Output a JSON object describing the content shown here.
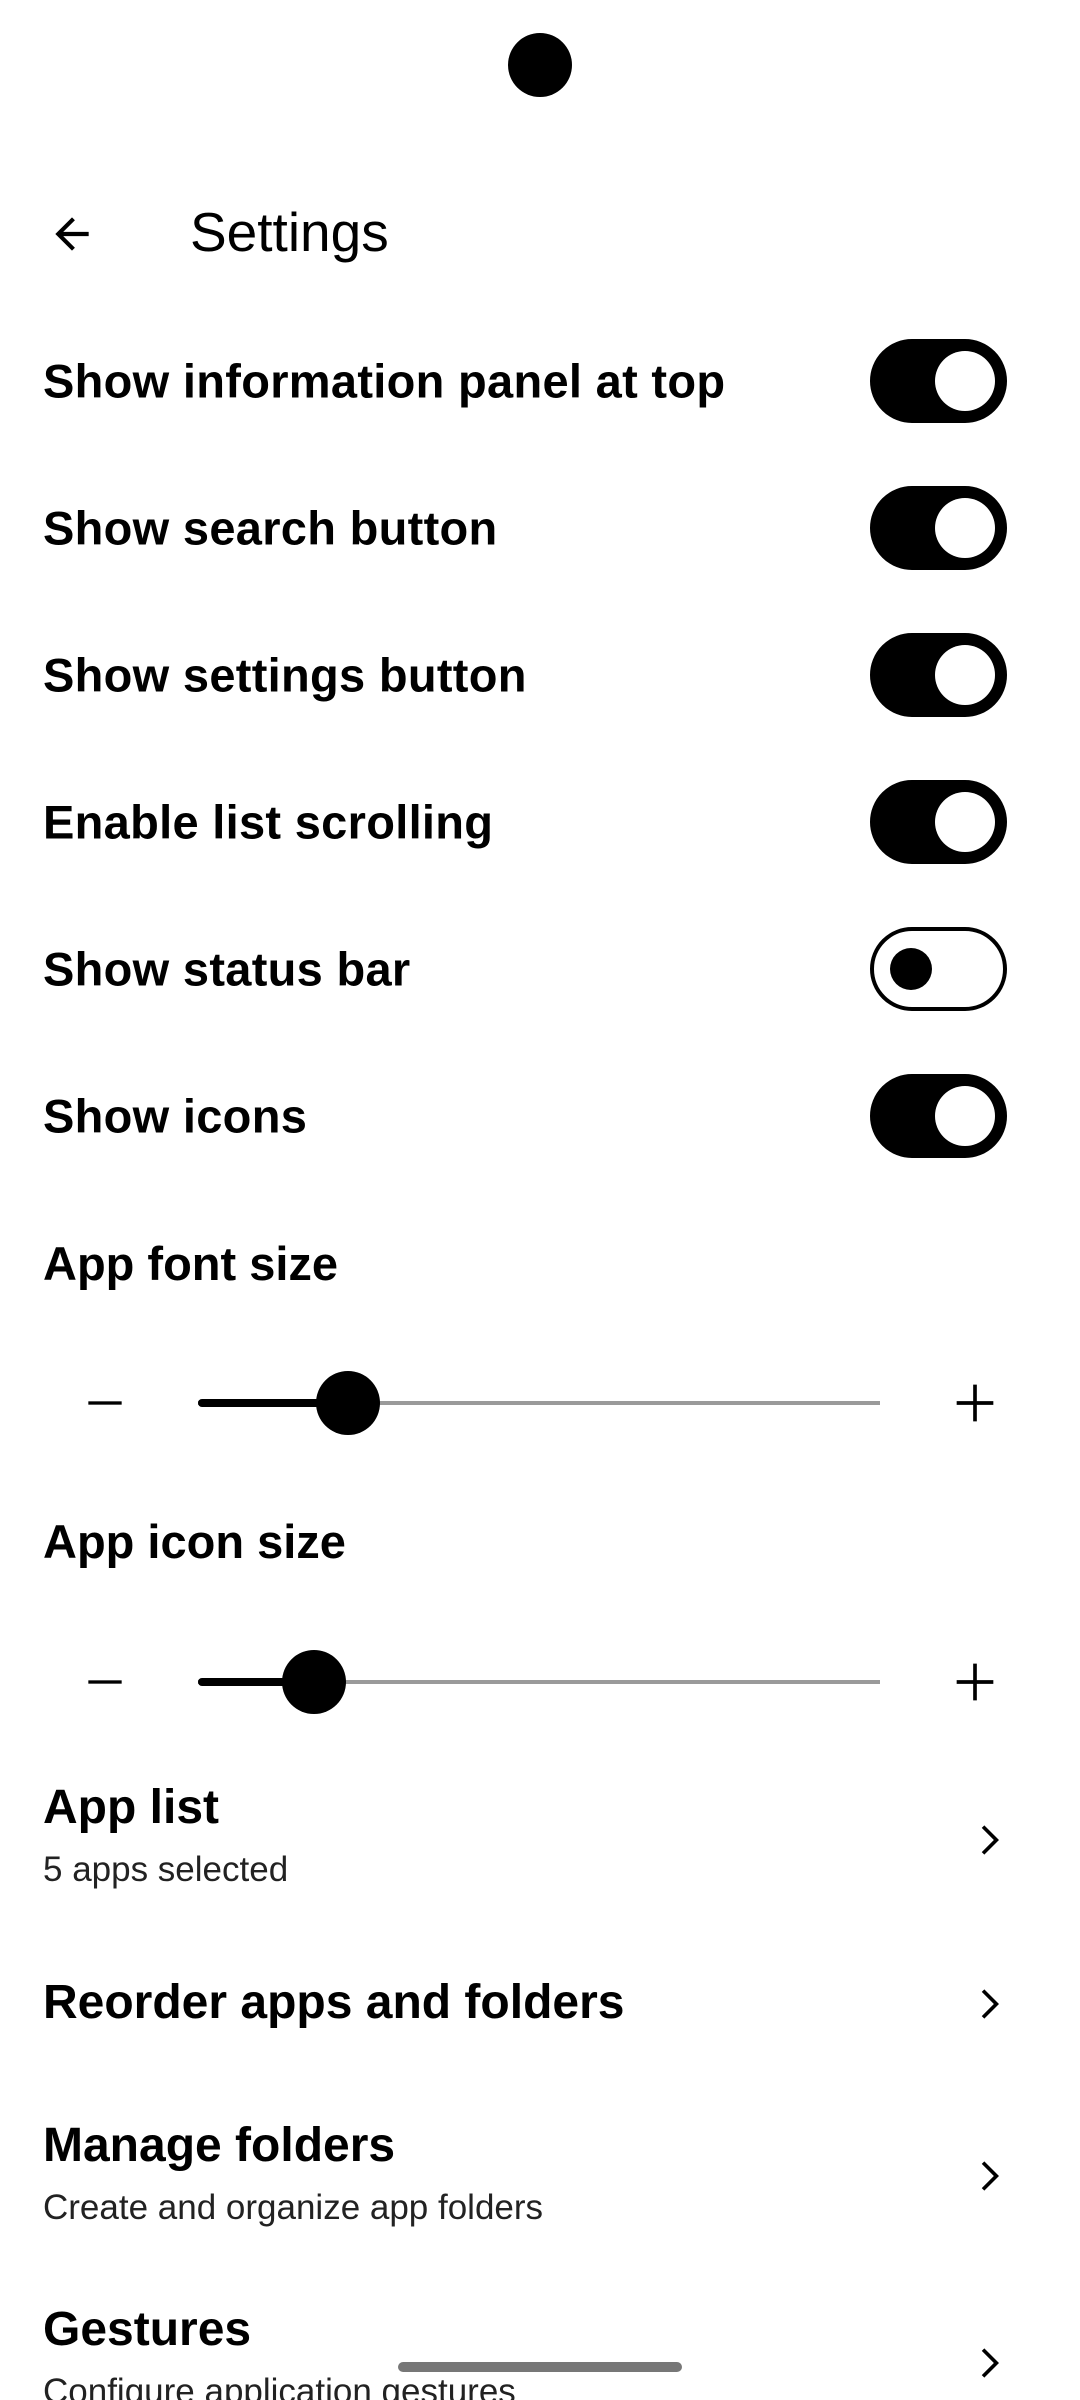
{
  "header": {
    "title": "Settings"
  },
  "toggles": [
    {
      "label": "Show information panel at top",
      "on": true
    },
    {
      "label": "Show search button",
      "on": true
    },
    {
      "label": "Show settings button",
      "on": true
    },
    {
      "label": "Enable list scrolling",
      "on": true
    },
    {
      "label": "Show status bar",
      "on": false
    },
    {
      "label": "Show icons",
      "on": true
    }
  ],
  "font_size": {
    "label": "App font size",
    "value_fraction": 0.22
  },
  "icon_size": {
    "label": "App icon size",
    "value_fraction": 0.17
  },
  "nav_items": [
    {
      "title": "App list",
      "subtitle": "5 apps selected"
    },
    {
      "title": "Reorder apps and folders",
      "subtitle": ""
    },
    {
      "title": "Manage folders",
      "subtitle": "Create and organize app folders"
    },
    {
      "title": "Gestures",
      "subtitle": "Configure application gestures"
    }
  ],
  "icons": {
    "back": "arrow-left-icon",
    "minus": "minus-icon",
    "plus": "plus-icon",
    "chevron": "chevron-right-icon"
  }
}
